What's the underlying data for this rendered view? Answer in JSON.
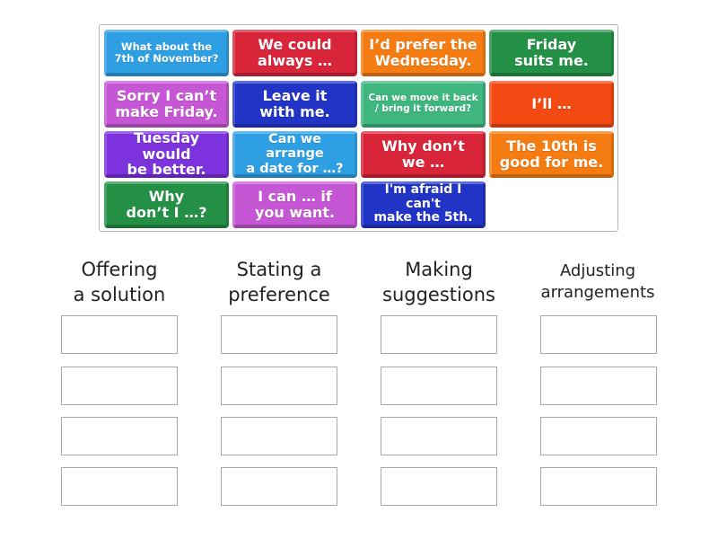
{
  "cards": [
    {
      "text": "What about the\n7th of November?",
      "color": "#2f9fe3"
    },
    {
      "text": "We could\nalways …",
      "color": "#d8253a"
    },
    {
      "text": "I’d prefer the\nWednesday.",
      "color": "#f47c12"
    },
    {
      "text": "Friday\nsuits me.",
      "color": "#249046"
    },
    {
      "text": "Sorry I can’t\nmake Friday.",
      "color": "#c556d4"
    },
    {
      "text": "Leave it\nwith me.",
      "color": "#2234c6"
    },
    {
      "text": "Can we move it back\n/ bring it forward?",
      "color": "#3fb57f"
    },
    {
      "text": "I’ll …",
      "color": "#f24a12"
    },
    {
      "text": "Tuesday would\nbe better.",
      "color": "#7c32dc"
    },
    {
      "text": "Can we arrange\na date for …?",
      "color": "#2f9fe3"
    },
    {
      "text": "Why don’t\nwe …",
      "color": "#d8253a"
    },
    {
      "text": "The 10th is\ngood for me.",
      "color": "#f47c12"
    },
    {
      "text": "Why\ndon’t I …?",
      "color": "#249046"
    },
    {
      "text": "I can … if\nyou want.",
      "color": "#c556d4"
    },
    {
      "text": "I'm afraid I can't\nmake the 5th.",
      "color": "#2234c6"
    }
  ],
  "categories": [
    {
      "title": "Offering\na solution"
    },
    {
      "title": "Stating a\npreference"
    },
    {
      "title": "Making\nsuggestions"
    },
    {
      "title": "Adjusting\narrangements"
    }
  ],
  "drop_slots_per_category": 4
}
